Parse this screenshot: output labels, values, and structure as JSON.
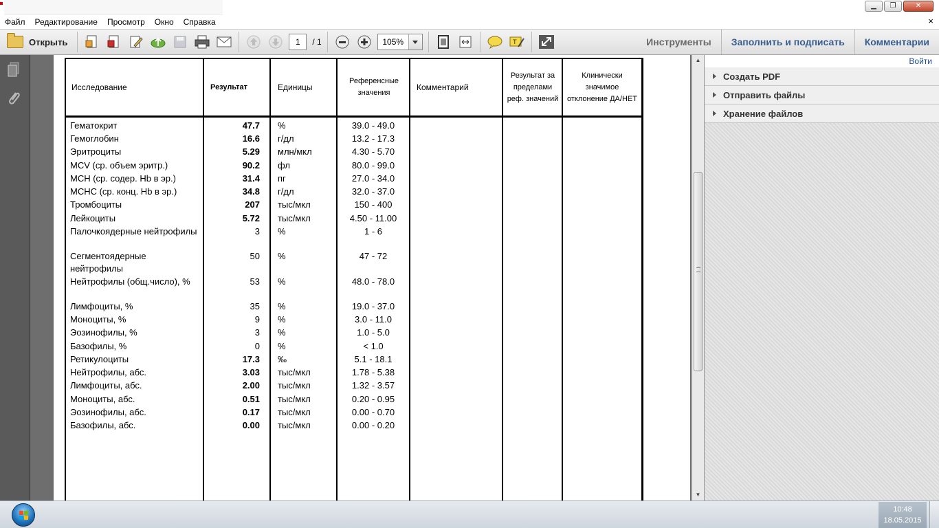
{
  "menu": {
    "items": [
      "Файл",
      "Редактирование",
      "Просмотр",
      "Окно",
      "Справка"
    ],
    "doc_close": "×"
  },
  "toolbar": {
    "open_label": "Открыть",
    "page_current": "1",
    "page_total": "/ 1",
    "zoom": "105%",
    "tools_label": "Инструменты",
    "fill_sign_label": "Заполнить и подписать",
    "comments_label": "Комментарии"
  },
  "right_panel": {
    "login_label": "Войти",
    "sections": [
      "Создать PDF",
      "Отправить файлы",
      "Хранение файлов"
    ]
  },
  "table": {
    "headers": {
      "study": "Исследование",
      "result": "Результат",
      "units": "Единицы",
      "reference": "Референсные значения",
      "comment": "Комментарий",
      "out_of_range": "Результат за пределами реф. значений",
      "clinical": "Клинически значимое отклонение ДА/НЕТ"
    },
    "rows": [
      {
        "name": "Гематокрит",
        "result": "47.7",
        "unit": "%",
        "ref": "39.0 - 49.0",
        "bold": true
      },
      {
        "name": "Гемоглобин",
        "result": "16.6",
        "unit": "г/дл",
        "ref": "13.2 - 17.3",
        "bold": true
      },
      {
        "name": "Эритроциты",
        "result": "5.29",
        "unit": "млн/мкл",
        "ref": "4.30 - 5.70",
        "bold": true
      },
      {
        "name": "MCV (ср. объем эритр.)",
        "result": "90.2",
        "unit": "фл",
        "ref": "80.0 - 99.0",
        "bold": true
      },
      {
        "name": "MCH (ср. содер. Hb в эр.)",
        "result": "31.4",
        "unit": "пг",
        "ref": "27.0 - 34.0",
        "bold": true
      },
      {
        "name": "MCHC (ср. конц. Hb в эр.)",
        "result": "34.8",
        "unit": "г/дл",
        "ref": "32.0 - 37.0",
        "bold": true
      },
      {
        "name": "Тромбоциты",
        "result": "207",
        "unit": "тыс/мкл",
        "ref": "150 - 400",
        "bold": true
      },
      {
        "name": "Лейкоциты",
        "result": "5.72",
        "unit": "тыс/мкл",
        "ref": "4.50 - 11.00",
        "bold": true
      },
      {
        "name": "Палочкоядерные нейтрофилы",
        "result": "3",
        "unit": "%",
        "ref": "1 - 6",
        "bold": false
      },
      {
        "name": "Сегментоядерные нейтрофилы",
        "result": "50",
        "unit": "%",
        "ref": "47 - 72",
        "bold": false
      },
      {
        "name": "Нейтрофилы (общ.число), %",
        "result": "53",
        "unit": "%",
        "ref": "48.0 - 78.0",
        "bold": false
      },
      {
        "name": "Лимфоциты, %",
        "result": "35",
        "unit": "%",
        "ref": "19.0 - 37.0",
        "bold": false
      },
      {
        "name": "Моноциты, %",
        "result": "9",
        "unit": "%",
        "ref": "3.0 - 11.0",
        "bold": false
      },
      {
        "name": "Эозинофилы, %",
        "result": "3",
        "unit": "%",
        "ref": "1.0 - 5.0",
        "bold": false
      },
      {
        "name": "Базофилы, %",
        "result": "0",
        "unit": "%",
        "ref": "< 1.0",
        "bold": false
      },
      {
        "name": "Ретикулоциты",
        "result": "17.3",
        "unit": "‰",
        "ref": "5.1 - 18.1",
        "bold": true
      },
      {
        "name": "Нейтрофилы, абс.",
        "result": "3.03",
        "unit": "тыс/мкл",
        "ref": "1.78 - 5.38",
        "bold": true
      },
      {
        "name": "Лимфоциты, абс.",
        "result": "2.00",
        "unit": "тыс/мкл",
        "ref": "1.32 - 3.57",
        "bold": true
      },
      {
        "name": "Моноциты, абс.",
        "result": "0.51",
        "unit": "тыс/мкл",
        "ref": "0.20 - 0.95",
        "bold": true
      },
      {
        "name": "Эозинофилы, абс.",
        "result": "0.17",
        "unit": "тыс/мкл",
        "ref": "0.00 - 0.70",
        "bold": true
      },
      {
        "name": "Базофилы, абс.",
        "result": "0.00",
        "unit": "тыс/мкл",
        "ref": "0.00 - 0.20",
        "bold": true
      }
    ]
  },
  "taskbar": {
    "time": "10:48",
    "date": "18.05.2015"
  }
}
